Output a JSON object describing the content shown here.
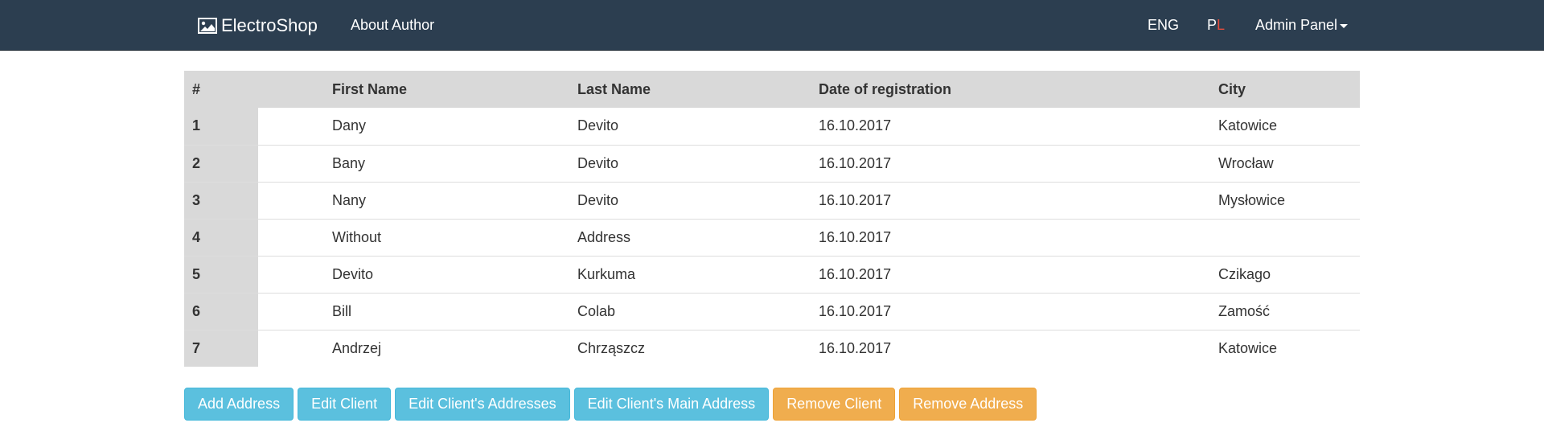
{
  "navbar": {
    "brand": "ElectroShop",
    "brand_icon": "image-icon",
    "about": "About Author",
    "lang_eng": "ENG",
    "lang_pl_p": "P",
    "lang_pl_l": "L",
    "admin": "Admin Panel",
    "colors": {
      "background": "#2c3e50",
      "pl_accent": "#e74c3c"
    }
  },
  "table": {
    "headers": [
      "#",
      "First Name",
      "Last Name",
      "Date of registration",
      "City"
    ],
    "rows": [
      [
        "1",
        "Dany",
        "Devito",
        "16.10.2017",
        "Katowice"
      ],
      [
        "2",
        "Bany",
        "Devito",
        "16.10.2017",
        "Wrocław"
      ],
      [
        "3",
        "Nany",
        "Devito",
        "16.10.2017",
        "Mysłowice"
      ],
      [
        "4",
        "Without",
        "Address",
        "16.10.2017",
        ""
      ],
      [
        "5",
        "Devito",
        "Kurkuma",
        "16.10.2017",
        "Czikago"
      ],
      [
        "6",
        "Bill",
        "Colab",
        "16.10.2017",
        "Zamość"
      ],
      [
        "7",
        "Andrzej",
        "Chrząszcz",
        "16.10.2017",
        "Katowice"
      ]
    ]
  },
  "buttons": {
    "add_address": "Add Address",
    "edit_client": "Edit Client",
    "edit_client_addresses": "Edit Client's Addresses",
    "edit_client_main_address": "Edit Client's Main Address",
    "remove_client": "Remove Client",
    "remove_address": "Remove Address",
    "colors": {
      "info": "#5bc0de",
      "warning": "#f0ad4e"
    }
  }
}
